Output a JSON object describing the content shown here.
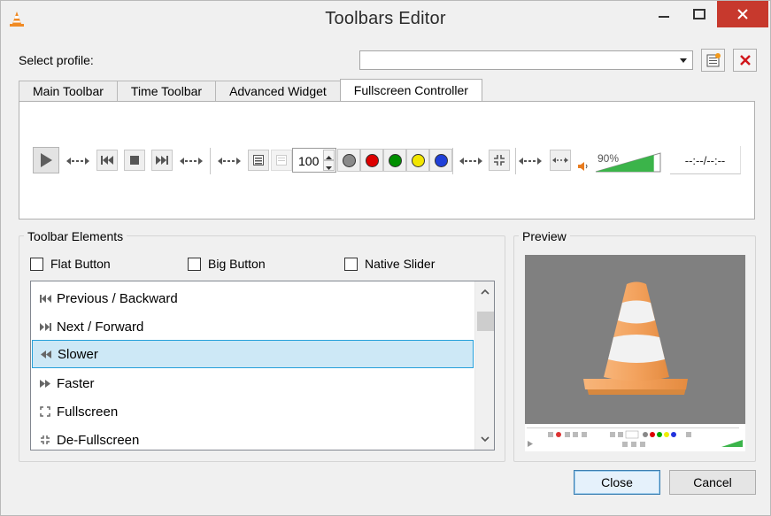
{
  "window": {
    "title": "Toolbars Editor"
  },
  "profile": {
    "label": "Select profile:",
    "value": ""
  },
  "tabs": [
    {
      "label": "Main Toolbar"
    },
    {
      "label": "Time Toolbar"
    },
    {
      "label": "Advanced Widget"
    },
    {
      "label": "Fullscreen Controller",
      "active": true
    }
  ],
  "toolbar_preview": {
    "speed_value": "100",
    "volume_percent": "90%",
    "volume_level": 0.9,
    "time_display": "--:--/--:--",
    "color_dots": [
      "#8a8a8a",
      "#dd0000",
      "#008f00",
      "#f2e600",
      "#1f3fd8"
    ]
  },
  "elements": {
    "title": "Toolbar Elements",
    "checkboxes": [
      {
        "label": "Flat Button",
        "checked": false
      },
      {
        "label": "Big Button",
        "checked": false
      },
      {
        "label": "Native Slider",
        "checked": false
      }
    ],
    "items": [
      {
        "label": "Previous / Backward",
        "icon": "previous-icon"
      },
      {
        "label": "Next / Forward",
        "icon": "next-icon"
      },
      {
        "label": "Slower",
        "icon": "slower-icon",
        "selected": true
      },
      {
        "label": "Faster",
        "icon": "faster-icon"
      },
      {
        "label": "Fullscreen",
        "icon": "fullscreen-icon"
      },
      {
        "label": "De-Fullscreen",
        "icon": "defullscreen-icon"
      }
    ]
  },
  "preview": {
    "title": "Preview"
  },
  "buttons": {
    "close": "Close",
    "cancel": "Cancel"
  },
  "colors": {
    "accent": "#26a0da",
    "selection": "#cde8f6",
    "close_hover": "#c7392d",
    "cone_orange": "#f5a25c"
  }
}
